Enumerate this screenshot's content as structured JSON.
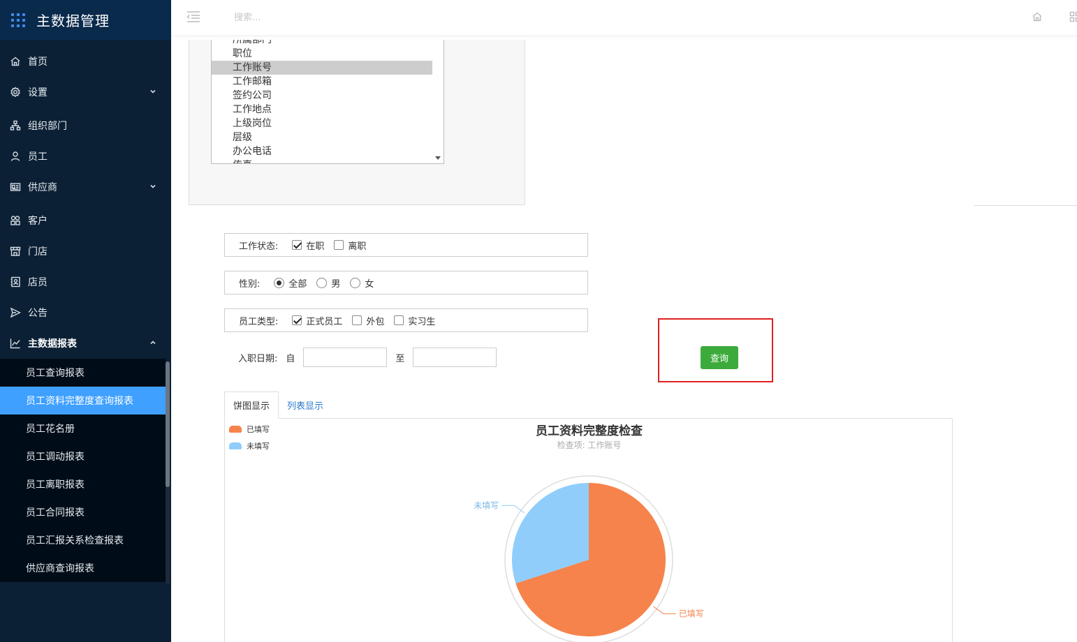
{
  "app": {
    "title": "主数据管理"
  },
  "sidebar": {
    "items": [
      {
        "label": "首页",
        "icon": "home-icon"
      },
      {
        "label": "设置",
        "icon": "gear-icon",
        "chevron": "down"
      },
      {
        "label": "组织部门",
        "icon": "org-chart-icon"
      },
      {
        "label": "员工",
        "icon": "user-icon"
      },
      {
        "label": "供应商",
        "icon": "id-card-icon",
        "chevron": "down"
      },
      {
        "label": "客户",
        "icon": "customer-icon"
      },
      {
        "label": "门店",
        "icon": "store-icon"
      },
      {
        "label": "店员",
        "icon": "clerk-icon"
      },
      {
        "label": "公告",
        "icon": "send-icon"
      },
      {
        "label": "主数据报表",
        "icon": "line-chart-icon",
        "chevron": "up"
      }
    ],
    "submenu": [
      "员工查询报表",
      "员工资料完整度查询报表",
      "员工花名册",
      "员工调动报表",
      "员工离职报表",
      "员工合同报表",
      "员工汇报关系检查报表",
      "供应商查询报表"
    ],
    "active_submenu_index": 1
  },
  "topbar": {
    "search_placeholder": "搜索..."
  },
  "field_list": {
    "options": [
      "所属部门",
      "职位",
      "工作账号",
      "工作邮箱",
      "签约公司",
      "工作地点",
      "上级岗位",
      "层级",
      "办公电话",
      "传真"
    ],
    "selected": "工作账号"
  },
  "filters": {
    "work_status": {
      "label": "工作状态:",
      "options": [
        {
          "text": "在职",
          "checked": true
        },
        {
          "text": "离职",
          "checked": false
        }
      ]
    },
    "gender": {
      "label": "性别:",
      "options": [
        {
          "text": "全部",
          "checked": true
        },
        {
          "text": "男",
          "checked": false
        },
        {
          "text": "女",
          "checked": false
        }
      ]
    },
    "employee_type": {
      "label": "员工类型:",
      "options": [
        {
          "text": "正式员工",
          "checked": true
        },
        {
          "text": "外包",
          "checked": false
        },
        {
          "text": "实习生",
          "checked": false
        }
      ]
    },
    "hire_date": {
      "label": "入职日期:",
      "from_label": "自",
      "to_label": "至",
      "from_value": "",
      "to_value": ""
    }
  },
  "query_button": "查询",
  "tabs": [
    {
      "label": "饼图显示",
      "active": true
    },
    {
      "label": "列表显示",
      "active": false
    }
  ],
  "chart_data": {
    "type": "pie",
    "title": "员工资料完整度检查",
    "subtitle": "检查项: 工作账号",
    "legend_position": "top-left",
    "labels": [
      "已填写",
      "未填写"
    ],
    "values": [
      70,
      30
    ],
    "colors": [
      "#f6834b",
      "#90cdfa"
    ],
    "label_colors": [
      "#f6834b",
      "#7ab7e6"
    ]
  }
}
